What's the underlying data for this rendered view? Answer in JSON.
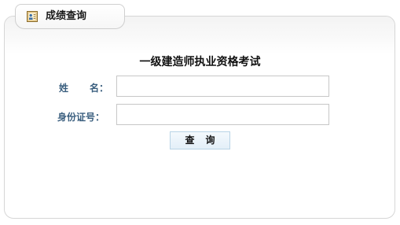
{
  "tab": {
    "title": "成绩查询",
    "icon": "document-icon"
  },
  "form": {
    "exam_title": "一级建造师执业资格考试",
    "name_label_left": "姓",
    "name_label_right": "名：",
    "name_value": "",
    "id_label": "身份证号：",
    "id_value": "",
    "submit_label": "查询"
  },
  "colors": {
    "label": "#3b5f7f",
    "button_border": "#b9d4e6",
    "button_fill": "#e3eff8",
    "panel_border": "#d6d6d6"
  }
}
